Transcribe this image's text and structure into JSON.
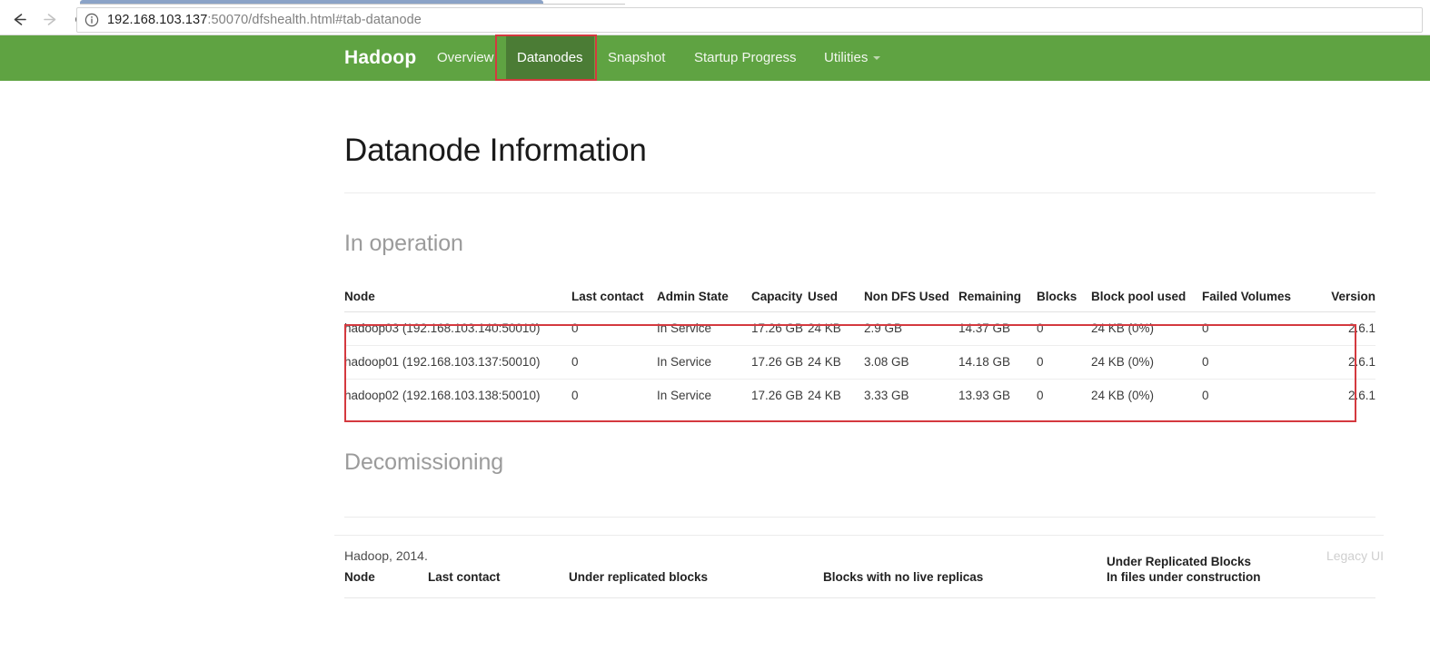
{
  "browser": {
    "back_icon": "back-arrow-icon",
    "forward_icon": "forward-arrow-icon",
    "reload_icon": "reload-icon",
    "site_info_icon": "info-circle-icon",
    "url_host": "192.168.103.137",
    "url_rest": ":50070/dfshealth.html#tab-datanode",
    "url_full": "192.168.103.137:50070/dfshealth.html#tab-datanode"
  },
  "navbar": {
    "brand": "Hadoop",
    "brand_color": "#ffffff",
    "background_color": "#5FA342",
    "active_background_color": "#4B7C35",
    "annotation_color": "#d4393f",
    "links": [
      {
        "label": "Overview",
        "active": false,
        "has_caret": false
      },
      {
        "label": "Datanodes",
        "active": true,
        "has_caret": false
      },
      {
        "label": "Snapshot",
        "active": false,
        "has_caret": false
      },
      {
        "label": "Startup Progress",
        "active": false,
        "has_caret": false
      },
      {
        "label": "Utilities",
        "active": false,
        "has_caret": true
      }
    ]
  },
  "page": {
    "title": "Datanode Information",
    "in_operation_heading": "In operation",
    "decommissioning_heading": "Decomissioning"
  },
  "in_operation_table": {
    "columns": [
      "Node",
      "Last contact",
      "Admin State",
      "Capacity",
      "Used",
      "Non DFS Used",
      "Remaining",
      "Blocks",
      "Block pool used",
      "Failed Volumes",
      "Version"
    ],
    "rows": [
      {
        "node": "hadoop03 (192.168.103.140:50010)",
        "last_contact": "0",
        "admin_state": "In Service",
        "capacity": "17.26 GB",
        "used": "24 KB",
        "non_dfs_used": "2.9 GB",
        "remaining": "14.37 GB",
        "blocks": "0",
        "block_pool_used": "24 KB (0%)",
        "failed_volumes": "0",
        "version": "2.6.1"
      },
      {
        "node": "hadoop01 (192.168.103.137:50010)",
        "last_contact": "0",
        "admin_state": "In Service",
        "capacity": "17.26 GB",
        "used": "24 KB",
        "non_dfs_used": "3.08 GB",
        "remaining": "14.18 GB",
        "blocks": "0",
        "block_pool_used": "24 KB (0%)",
        "failed_volumes": "0",
        "version": "2.6.1"
      },
      {
        "node": "hadoop02 (192.168.103.138:50010)",
        "last_contact": "0",
        "admin_state": "In Service",
        "capacity": "17.26 GB",
        "used": "24 KB",
        "non_dfs_used": "3.33 GB",
        "remaining": "13.93 GB",
        "blocks": "0",
        "block_pool_used": "24 KB (0%)",
        "failed_volumes": "0",
        "version": "2.6.1"
      }
    ]
  },
  "decommissioning_table": {
    "columns": [
      "Node",
      "Last contact",
      "Under replicated blocks",
      "Blocks with no live replicas",
      "Under Replicated Blocks\nIn files under construction"
    ],
    "col_urb_line1": "Under Replicated Blocks",
    "col_urb_line2": "In files under construction",
    "rows": []
  },
  "footer": {
    "left": "Hadoop, 2014.",
    "right": "Legacy UI"
  }
}
